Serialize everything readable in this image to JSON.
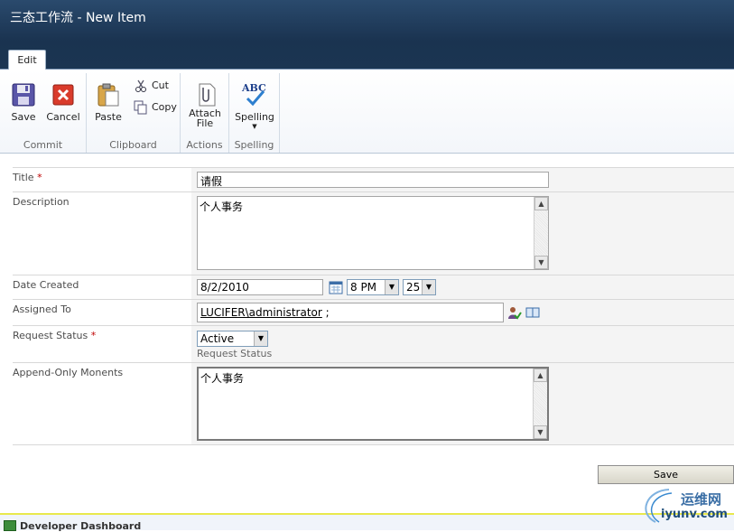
{
  "window": {
    "title": "三态工作流 - New Item"
  },
  "ribbon": {
    "tab_edit": "Edit",
    "groups": {
      "commit": {
        "label": "Commit",
        "save": "Save",
        "cancel": "Cancel"
      },
      "clipboard": {
        "label": "Clipboard",
        "paste": "Paste",
        "cut": "Cut",
        "copy": "Copy"
      },
      "actions": {
        "label": "Actions",
        "attach_line1": "Attach",
        "attach_line2": "File"
      },
      "spelling": {
        "label": "Spelling",
        "spelling": "Spelling",
        "icon_text": "ABC"
      }
    }
  },
  "form": {
    "title": {
      "label": "Title",
      "required": "*",
      "value": "请假"
    },
    "description": {
      "label": "Description",
      "value": "个人事务"
    },
    "date_created": {
      "label": "Date Created",
      "date": "8/2/2010",
      "hour": "8 PM",
      "minute": "25"
    },
    "assigned_to": {
      "label": "Assigned To",
      "user": "LUCIFER\\administrator",
      "suffix": " ;"
    },
    "request_status": {
      "label": "Request Status",
      "required": "*",
      "value": "Active",
      "hint": "Request Status"
    },
    "append_only": {
      "label": "Append-Only Monents",
      "value": "个人事务"
    }
  },
  "buttons": {
    "save": "Save"
  },
  "footer": {
    "developer_dashboard": "Developer Dashboard"
  },
  "watermark": {
    "text1": "运维网",
    "text2": "iyunv.com"
  }
}
